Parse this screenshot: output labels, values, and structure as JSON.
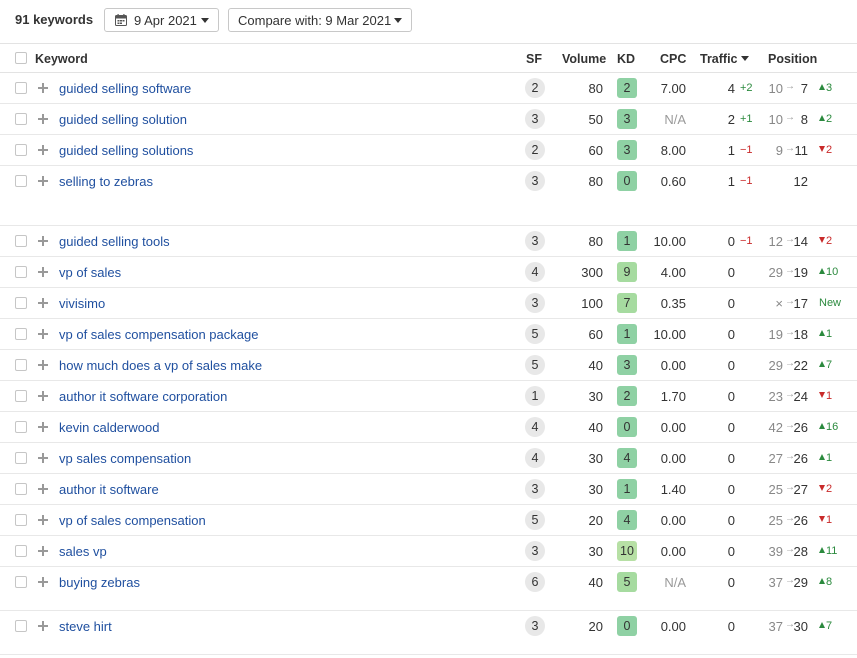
{
  "toolbar": {
    "keyword_count": "91 keywords",
    "date_label": "9 Apr 2021",
    "compare_label": "Compare with: 9 Mar 2021"
  },
  "columns": {
    "keyword": "Keyword",
    "sf": "SF",
    "volume": "Volume",
    "kd": "KD",
    "cpc": "CPC",
    "traffic": "Traffic",
    "position": "Position"
  },
  "kd_colors": {
    "low": "#8fd1a4",
    "mid": "#a6dba0",
    "higher": "#b7e0a5"
  },
  "rows": [
    {
      "keyword": "guided selling software",
      "sf": "2",
      "volume": "80",
      "kd": "2",
      "cpc": "7.00",
      "traffic": "4",
      "traffic_change": "+2",
      "traffic_dir": "up",
      "pos_old": "10",
      "pos_new": "7",
      "pos_change": "3",
      "pos_dir": "up"
    },
    {
      "keyword": "guided selling solution",
      "sf": "3",
      "volume": "50",
      "kd": "3",
      "cpc": "N/A",
      "traffic": "2",
      "traffic_change": "+1",
      "traffic_dir": "up",
      "pos_old": "10",
      "pos_new": "8",
      "pos_change": "2",
      "pos_dir": "up"
    },
    {
      "keyword": "guided selling solutions",
      "sf": "2",
      "volume": "60",
      "kd": "3",
      "cpc": "8.00",
      "traffic": "1",
      "traffic_change": "−1",
      "traffic_dir": "down",
      "pos_old": "9",
      "pos_new": "11",
      "pos_change": "2",
      "pos_dir": "down"
    },
    {
      "keyword": "selling to zebras",
      "sf": "3",
      "volume": "80",
      "kd": "0",
      "cpc": "0.60",
      "traffic": "1",
      "traffic_change": "−1",
      "traffic_dir": "down",
      "pos_old": "",
      "pos_new": "12",
      "pos_change": "",
      "pos_dir": "none"
    },
    {
      "keyword": "guided selling tools",
      "sf": "3",
      "volume": "80",
      "kd": "1",
      "cpc": "10.00",
      "traffic": "0",
      "traffic_change": "−1",
      "traffic_dir": "down",
      "pos_old": "12",
      "pos_new": "14",
      "pos_change": "2",
      "pos_dir": "down"
    },
    {
      "keyword": "vp of sales",
      "sf": "4",
      "volume": "300",
      "kd": "9",
      "cpc": "4.00",
      "traffic": "0",
      "traffic_change": "",
      "traffic_dir": "none",
      "pos_old": "29",
      "pos_new": "19",
      "pos_change": "10",
      "pos_dir": "up"
    },
    {
      "keyword": "vivisimo",
      "sf": "3",
      "volume": "100",
      "kd": "7",
      "cpc": "0.35",
      "traffic": "0",
      "traffic_change": "",
      "traffic_dir": "none",
      "pos_old": "×",
      "pos_new": "17",
      "pos_change": "New",
      "pos_dir": "new"
    },
    {
      "keyword": "vp of sales compensation package",
      "sf": "5",
      "volume": "60",
      "kd": "1",
      "cpc": "10.00",
      "traffic": "0",
      "traffic_change": "",
      "traffic_dir": "none",
      "pos_old": "19",
      "pos_new": "18",
      "pos_change": "1",
      "pos_dir": "up"
    },
    {
      "keyword": "how much does a vp of sales make",
      "sf": "5",
      "volume": "40",
      "kd": "3",
      "cpc": "0.00",
      "traffic": "0",
      "traffic_change": "",
      "traffic_dir": "none",
      "pos_old": "29",
      "pos_new": "22",
      "pos_change": "7",
      "pos_dir": "up"
    },
    {
      "keyword": "author it software corporation",
      "sf": "1",
      "volume": "30",
      "kd": "2",
      "cpc": "1.70",
      "traffic": "0",
      "traffic_change": "",
      "traffic_dir": "none",
      "pos_old": "23",
      "pos_new": "24",
      "pos_change": "1",
      "pos_dir": "down"
    },
    {
      "keyword": "kevin calderwood",
      "sf": "4",
      "volume": "40",
      "kd": "0",
      "cpc": "0.00",
      "traffic": "0",
      "traffic_change": "",
      "traffic_dir": "none",
      "pos_old": "42",
      "pos_new": "26",
      "pos_change": "16",
      "pos_dir": "up"
    },
    {
      "keyword": "vp sales compensation",
      "sf": "4",
      "volume": "30",
      "kd": "4",
      "cpc": "0.00",
      "traffic": "0",
      "traffic_change": "",
      "traffic_dir": "none",
      "pos_old": "27",
      "pos_new": "26",
      "pos_change": "1",
      "pos_dir": "up"
    },
    {
      "keyword": "author it software",
      "sf": "3",
      "volume": "30",
      "kd": "1",
      "cpc": "1.40",
      "traffic": "0",
      "traffic_change": "",
      "traffic_dir": "none",
      "pos_old": "25",
      "pos_new": "27",
      "pos_change": "2",
      "pos_dir": "down"
    },
    {
      "keyword": "vp of sales compensation",
      "sf": "5",
      "volume": "20",
      "kd": "4",
      "cpc": "0.00",
      "traffic": "0",
      "traffic_change": "",
      "traffic_dir": "none",
      "pos_old": "25",
      "pos_new": "26",
      "pos_change": "1",
      "pos_dir": "down"
    },
    {
      "keyword": "sales vp",
      "sf": "3",
      "volume": "30",
      "kd": "10",
      "cpc": "0.00",
      "traffic": "0",
      "traffic_change": "",
      "traffic_dir": "none",
      "pos_old": "39",
      "pos_new": "28",
      "pos_change": "11",
      "pos_dir": "up"
    },
    {
      "keyword": "buying zebras",
      "sf": "6",
      "volume": "40",
      "kd": "5",
      "cpc": "N/A",
      "traffic": "0",
      "traffic_change": "",
      "traffic_dir": "none",
      "pos_old": "37",
      "pos_new": "29",
      "pos_change": "8",
      "pos_dir": "up"
    },
    {
      "keyword": "steve hirt",
      "sf": "3",
      "volume": "20",
      "kd": "0",
      "cpc": "0.00",
      "traffic": "0",
      "traffic_change": "",
      "traffic_dir": "none",
      "pos_old": "37",
      "pos_new": "30",
      "pos_change": "7",
      "pos_dir": "up"
    }
  ]
}
